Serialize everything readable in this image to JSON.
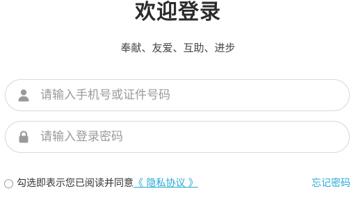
{
  "header": {
    "title": "欢迎登录",
    "subtitle": "奉献、友爱、互助、进步"
  },
  "form": {
    "phone": {
      "placeholder": "请输入手机号或证件号码",
      "value": "",
      "icon": "user-icon"
    },
    "password": {
      "placeholder": "请输入登录密码",
      "value": "",
      "icon": "lock-icon"
    }
  },
  "agreement": {
    "text": "勾选即表示您已阅读并同意",
    "link_label": "《 隐私协议 》",
    "checked": false
  },
  "forgot_password_label": "忘记密码",
  "colors": {
    "link": "#27a9d4",
    "icon": "#9a9a9a",
    "border": "#d9d9d9"
  }
}
